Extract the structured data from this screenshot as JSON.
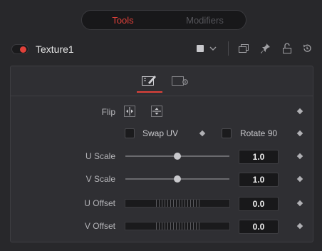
{
  "tabs": [
    {
      "label": "Tools",
      "active": true
    },
    {
      "label": "Modifiers",
      "active": false
    }
  ],
  "node": {
    "name": "Texture1",
    "enabled": true,
    "color_swatch": "#c8c8cc"
  },
  "header_icons": [
    "color-swatch-icon",
    "chevron-down-icon",
    "versions-icon",
    "pin-icon",
    "lock-icon",
    "reset-icon"
  ],
  "subtabs": [
    {
      "icon": "edit-settings-icon",
      "active": true
    },
    {
      "icon": "common-settings-icon",
      "active": false
    }
  ],
  "controls": {
    "flip": {
      "label": "Flip",
      "buttons": [
        "flip-horizontal-icon",
        "flip-vertical-icon"
      ]
    },
    "swap_uv": {
      "label": "Swap UV",
      "checked": false
    },
    "rotate_90": {
      "label": "Rotate 90",
      "checked": false
    },
    "u_scale": {
      "label": "U Scale",
      "value": "1.0",
      "level": 0.5
    },
    "v_scale": {
      "label": "V Scale",
      "value": "1.0",
      "level": 0.5
    },
    "u_offset": {
      "label": "U Offset",
      "value": "0.0"
    },
    "v_offset": {
      "label": "V Offset",
      "value": "0.0"
    }
  },
  "colors": {
    "accent": "#e0413a",
    "background": "#28282b",
    "panel": "#2f2f33"
  }
}
